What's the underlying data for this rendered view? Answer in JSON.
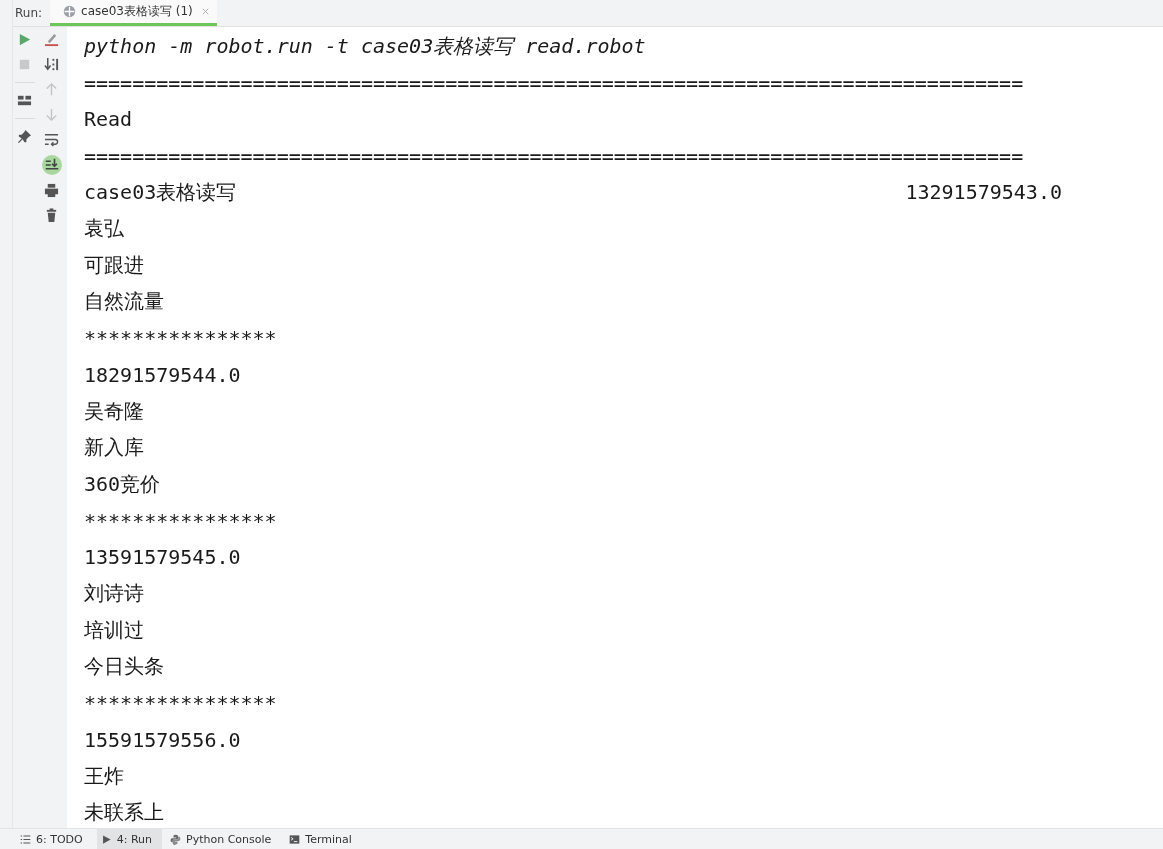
{
  "run_bar": {
    "label": "Run:",
    "tabs": [
      {
        "title": "case03表格读写 (1)",
        "selected": true
      }
    ]
  },
  "console": {
    "lines": [
      {
        "kind": "command",
        "text": "python -m robot.run -t case03表格读写 read.robot"
      },
      {
        "kind": "plain",
        "text": "=============================================================================="
      },
      {
        "kind": "plain",
        "text": "Read"
      },
      {
        "kind": "plain",
        "text": "=============================================================================="
      },
      {
        "kind": "plain",
        "text": "case03表格读写",
        "aside": "13291579543.0"
      },
      {
        "kind": "plain",
        "text": "袁弘"
      },
      {
        "kind": "plain",
        "text": "可跟进"
      },
      {
        "kind": "plain",
        "text": "自然流量"
      },
      {
        "kind": "plain",
        "text": "****************"
      },
      {
        "kind": "plain",
        "text": "18291579544.0"
      },
      {
        "kind": "plain",
        "text": "吴奇隆"
      },
      {
        "kind": "plain",
        "text": "新入库"
      },
      {
        "kind": "plain",
        "text": "360竞价"
      },
      {
        "kind": "plain",
        "text": "****************"
      },
      {
        "kind": "plain",
        "text": "13591579545.0"
      },
      {
        "kind": "plain",
        "text": "刘诗诗"
      },
      {
        "kind": "plain",
        "text": "培训过"
      },
      {
        "kind": "plain",
        "text": "今日头条"
      },
      {
        "kind": "plain",
        "text": "****************"
      },
      {
        "kind": "plain",
        "text": "15591579556.0"
      },
      {
        "kind": "plain",
        "text": "王炸"
      },
      {
        "kind": "plain",
        "text": "未联系上"
      }
    ]
  },
  "tool_windows": [
    {
      "kind": "list",
      "label": "6: TODO",
      "selected": false
    },
    {
      "kind": "play",
      "label": "4: Run",
      "selected": true
    },
    {
      "kind": "python",
      "label": "Python Console",
      "selected": false
    },
    {
      "kind": "terminal",
      "label": "Terminal",
      "selected": false
    }
  ]
}
